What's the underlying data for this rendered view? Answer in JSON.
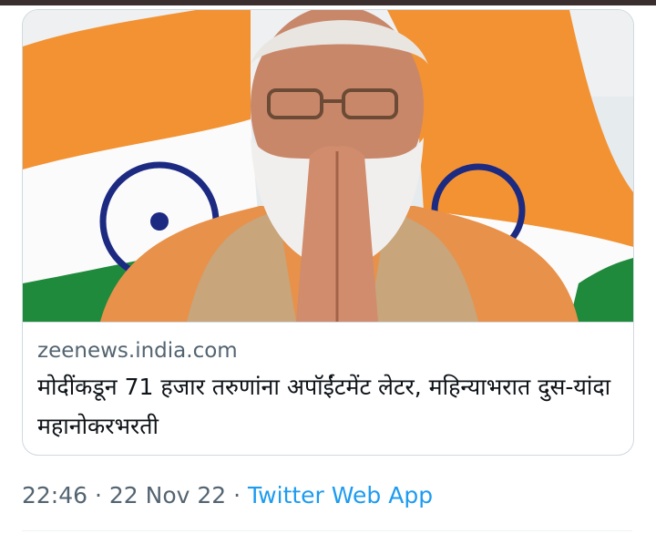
{
  "card": {
    "image_alt_icon": "photo-thumbnail",
    "domain": "zeenews.india.com",
    "title": "मोदींकडून 71 हजार तरुणांना अपॉईंटमेंट लेटर, महिन्याभरात दुस-यांदा महानोकरभरती"
  },
  "tweet_meta": {
    "time": "22:46",
    "separator1": " · ",
    "date": "22 Nov 22",
    "separator2": " · ",
    "source_app": "Twitter Web App"
  },
  "colors": {
    "meta_text": "#536471",
    "link_blue": "#1d9bf0",
    "border": "#cfd9de"
  }
}
